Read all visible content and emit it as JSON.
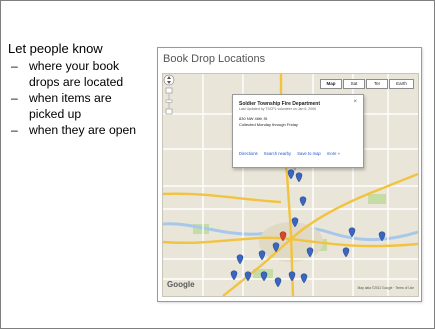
{
  "slide": {
    "heading": "Let people know",
    "bullets": [
      "where your book drops are located",
      "when items are picked up",
      "when they are open"
    ],
    "bullet_marker": "–"
  },
  "screenshot": {
    "title": "Book Drop Locations",
    "map": {
      "zoom_icon": "pan-zoom-control-icon",
      "map_types": [
        {
          "label": "Map",
          "active": true
        },
        {
          "label": "Sat",
          "active": false
        },
        {
          "label": "Ter",
          "active": false
        },
        {
          "label": "Earth",
          "active": false
        }
      ],
      "info_window": {
        "title": "Soldier Township Fire Department",
        "subtitle": "Last Updated by TSCPL volunteer on Jan 6, 2006",
        "address": "830 NW 46th St",
        "hours": "Collected Monday through Friday",
        "close": "×",
        "links": [
          "Directions",
          "Search nearby",
          "Save to map",
          "more »"
        ]
      },
      "logo": "Google",
      "attribution": "Map data ©2012 Google · Terms of Use",
      "colors": {
        "land": "#e9e5d8",
        "highway": "#f2c33f",
        "arterial": "#ffffff",
        "park": "#c5dca5",
        "water": "#a8c8ea",
        "marker": "#3a66c0",
        "selected_marker": "#d8462f"
      }
    }
  }
}
